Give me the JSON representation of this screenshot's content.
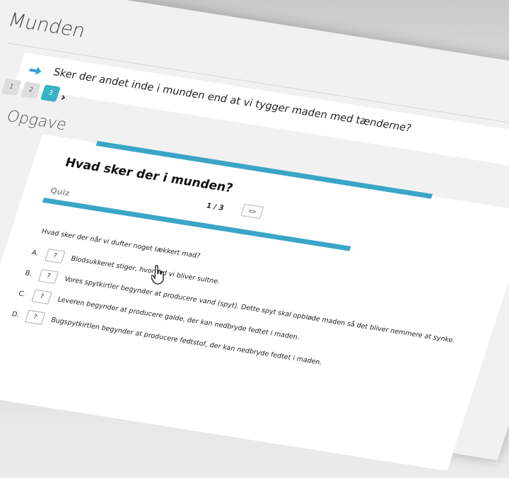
{
  "page": {
    "title": "Munden"
  },
  "question": {
    "text": "Sker der andet inde i munden end at vi tygger maden med tænderne?"
  },
  "pager": {
    "pages": [
      "1",
      "2",
      "3"
    ],
    "active": "3"
  },
  "section": {
    "title": "Opgave"
  },
  "quiz": {
    "title": "Hvad sker der i munden?",
    "label": "Quiz",
    "counter": "1 / 3",
    "next_label": "=>",
    "question": "Hvad sker der når vi dufter noget lækkert mad?",
    "options": [
      {
        "letter": "A.",
        "answer": "?",
        "text": "Blodsukkeret stiger, hvorved vi bliver sultne."
      },
      {
        "letter": "B.",
        "answer": "?",
        "text": "Vores spytkirtler begynder at producere vand (spyt). Dette spyt skal opbløde maden så det bliver nemmere at synke."
      },
      {
        "letter": "C.",
        "answer": "?",
        "text": "Leveren begynder at producere galde, der kan nedbryde fedtet i maden."
      },
      {
        "letter": "D.",
        "answer": "?",
        "text": "Bugspytkirtlen begynder at producere fedtstof, der kan nedbryde fedtet i maden."
      }
    ]
  },
  "colors": {
    "accent": "#3ba5c7",
    "active_page": "#38b2c7",
    "arrow": "#3a9fd4"
  }
}
